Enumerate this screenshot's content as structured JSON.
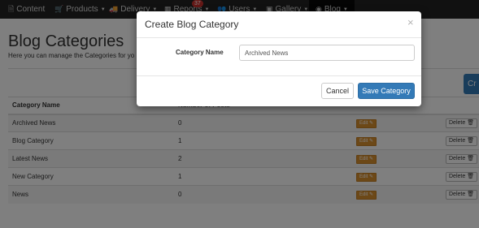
{
  "nav": {
    "items": [
      {
        "label": "Content",
        "icon": "file-icon",
        "glyph": "🗎",
        "caret": false
      },
      {
        "label": "Products",
        "icon": "cart-icon",
        "glyph": "🛒",
        "caret": true
      },
      {
        "label": "Delivery",
        "icon": "truck-icon",
        "glyph": "🚚",
        "caret": true
      },
      {
        "label": "Reports",
        "icon": "chart-icon",
        "glyph": "▦",
        "caret": true
      },
      {
        "label": "Users",
        "icon": "users-icon",
        "glyph": "👥",
        "caret": true
      },
      {
        "label": "Gallery",
        "icon": "image-icon",
        "glyph": "▣",
        "caret": true
      },
      {
        "label": "Blog",
        "icon": "rss-icon",
        "glyph": "◉",
        "caret": true
      }
    ],
    "reports_badge": "37"
  },
  "page": {
    "title": "Blog Categories",
    "subtitle": "Here you can manage the Categories for yo",
    "create_button_label": "Cr"
  },
  "table": {
    "headers": [
      "Category Name",
      "Number of Posts"
    ],
    "edit_label": "Edit",
    "delete_label": "Delete",
    "rows": [
      {
        "name": "Archived News",
        "posts": "0"
      },
      {
        "name": "Blog Category",
        "posts": "1"
      },
      {
        "name": "Latest News",
        "posts": "2"
      },
      {
        "name": "New Category",
        "posts": "1"
      },
      {
        "name": "News",
        "posts": "0"
      }
    ]
  },
  "modal": {
    "title": "Create Blog Category",
    "close_glyph": "×",
    "field_label": "Category Name",
    "field_value": "Archived News",
    "cancel_label": "Cancel",
    "save_label": "Save Category"
  },
  "colors": {
    "navbar": "#222222",
    "primary": "#337ab7",
    "edit": "#d9902f",
    "backdrop": "rgba(0,0,0,0.5)"
  }
}
